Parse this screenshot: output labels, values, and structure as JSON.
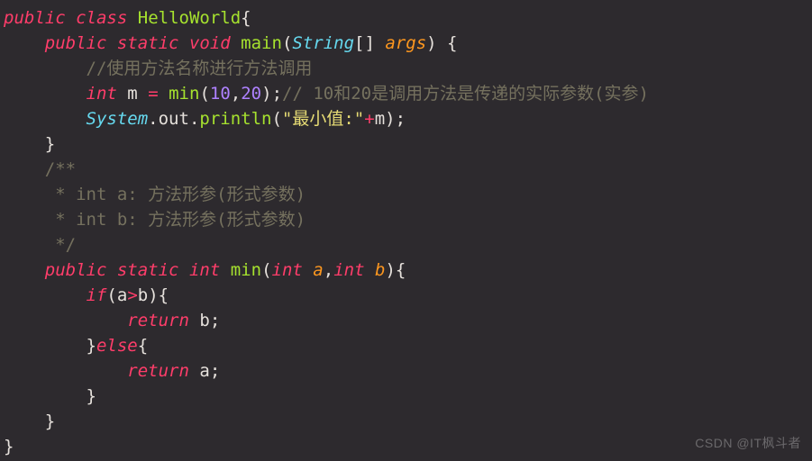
{
  "code": {
    "l1": {
      "kw_public": "public",
      "kw_class": "class",
      "cls": "HelloWorld",
      "brace": "{"
    },
    "l2": {
      "kw_public": "public",
      "kw_static": "static",
      "kw_void": "void",
      "fn": "main",
      "lp": "(",
      "type": "String",
      "arr": "[]",
      "param": "args",
      "rp": ")",
      "brace": "{"
    },
    "l3": {
      "cm": "//使用方法名称进行方法调用"
    },
    "l4": {
      "kw_int": "int",
      "id_m": "m",
      "eq": "=",
      "fn": "min",
      "lp": "(",
      "n1": "10",
      "comma": ",",
      "n2": "20",
      "rp": ")",
      "semi": ";",
      "cm": "// 10和20是调用方法是传递的实际参数(实参)"
    },
    "l5": {
      "sys": "System",
      "dot1": ".",
      "out": "out",
      "dot2": ".",
      "fn": "println",
      "lp": "(",
      "str": "\"最小值:\"",
      "plus": "+",
      "id_m": "m",
      "rp": ")",
      "semi": ";"
    },
    "l6": {
      "brace": "}"
    },
    "l7": {
      "cm": "/**"
    },
    "l8": {
      "cm": " * int a: 方法形参(形式参数)"
    },
    "l9": {
      "cm": " * int b: 方法形参(形式参数)"
    },
    "l10": {
      "cm": " */"
    },
    "l11": {
      "kw_public": "public",
      "kw_static": "static",
      "kw_int": "int",
      "fn": "min",
      "lp": "(",
      "kw_int_a": "int",
      "pa": "a",
      "comma": ",",
      "kw_int_b": "int",
      "pb": "b",
      "rp": ")",
      "brace": "{"
    },
    "l12": {
      "kw_if": "if",
      "lp": "(",
      "id_a": "a",
      "gt": ">",
      "id_b": "b",
      "rp": ")",
      "brace": "{"
    },
    "l13": {
      "kw_return": "return",
      "id_b": "b",
      "semi": ";"
    },
    "l14": {
      "rbrace": "}",
      "kw_else": "else",
      "lbrace": "{"
    },
    "l15": {
      "kw_return": "return",
      "id_a": "a",
      "semi": ";"
    },
    "l16": {
      "brace": "}"
    },
    "l17": {
      "brace": "}"
    },
    "l18": {
      "brace": "}"
    }
  },
  "watermark": "CSDN @IT枫斗者"
}
